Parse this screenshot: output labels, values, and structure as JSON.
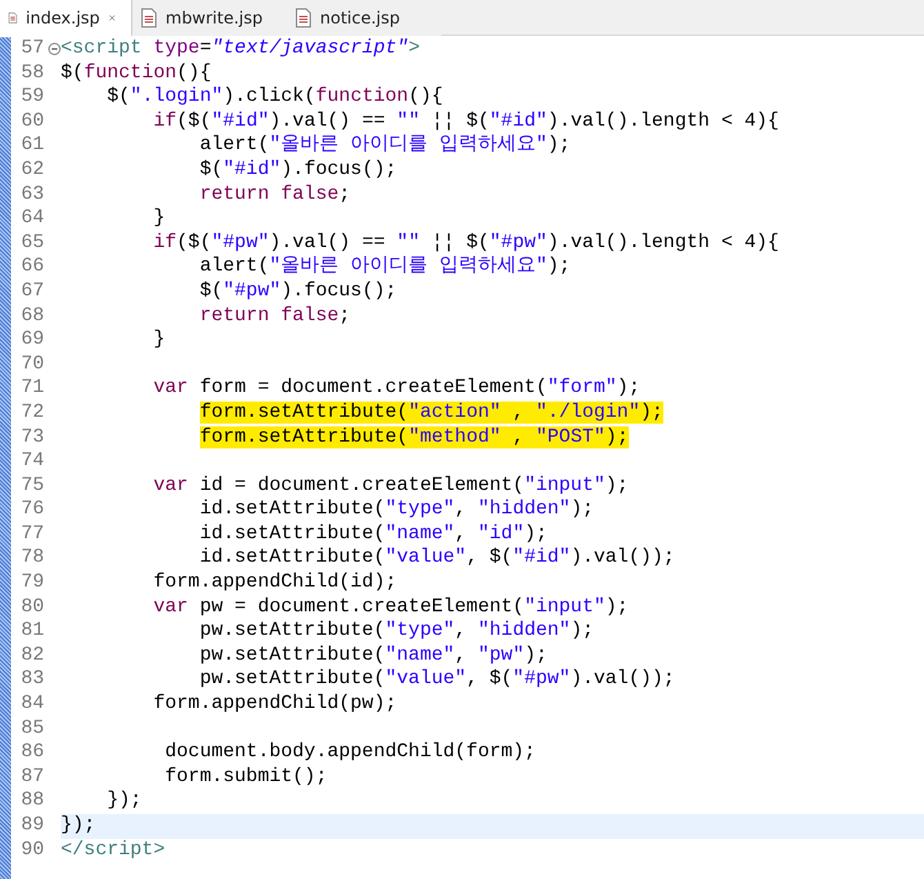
{
  "tabs": [
    {
      "label": "index.jsp",
      "selected": true
    },
    {
      "label": "mbwrite.jsp",
      "selected": false
    },
    {
      "label": "notice.jsp",
      "selected": false
    }
  ],
  "lines": [
    {
      "number": "57",
      "fold": true,
      "tokens": [
        {
          "kind": "tag",
          "text": "<script"
        },
        {
          "kind": "attr",
          "text": " type"
        },
        {
          "kind": "plain",
          "text": "="
        },
        {
          "kind": "attrvalue",
          "text": "\"text/javascript\""
        },
        {
          "kind": "tag",
          "text": ">"
        }
      ]
    },
    {
      "number": "58",
      "tokens": [
        {
          "kind": "plain",
          "text": "$("
        },
        {
          "kind": "keyword",
          "text": "function"
        },
        {
          "kind": "plain",
          "text": "(){"
        }
      ]
    },
    {
      "number": "59",
      "tokens": [
        {
          "kind": "plain",
          "text": "    $("
        },
        {
          "kind": "string",
          "text": "\".login\""
        },
        {
          "kind": "plain",
          "text": ").click("
        },
        {
          "kind": "keyword",
          "text": "function"
        },
        {
          "kind": "plain",
          "text": "(){"
        }
      ]
    },
    {
      "number": "60",
      "tokens": [
        {
          "kind": "keyword",
          "text": "        if"
        },
        {
          "kind": "plain",
          "text": "($("
        },
        {
          "kind": "string",
          "text": "\"#id\""
        },
        {
          "kind": "plain",
          "text": ").val() == "
        },
        {
          "kind": "string",
          "text": "\"\""
        },
        {
          "kind": "plain",
          "text": " ¦¦ $("
        },
        {
          "kind": "string",
          "text": "\"#id\""
        },
        {
          "kind": "plain",
          "text": ").val().length < 4){"
        }
      ]
    },
    {
      "number": "61",
      "tokens": [
        {
          "kind": "plain",
          "text": "            alert("
        },
        {
          "kind": "string",
          "text": "\"올바른 아이디를 입력하세요\""
        },
        {
          "kind": "plain",
          "text": ");"
        }
      ]
    },
    {
      "number": "62",
      "tokens": [
        {
          "kind": "plain",
          "text": "            $("
        },
        {
          "kind": "string",
          "text": "\"#id\""
        },
        {
          "kind": "plain",
          "text": ").focus();"
        }
      ]
    },
    {
      "number": "63",
      "tokens": [
        {
          "kind": "keyword",
          "text": "            return false"
        },
        {
          "kind": "plain",
          "text": ";"
        }
      ]
    },
    {
      "number": "64",
      "tokens": [
        {
          "kind": "plain",
          "text": "        }"
        }
      ]
    },
    {
      "number": "65",
      "tokens": [
        {
          "kind": "keyword",
          "text": "        if"
        },
        {
          "kind": "plain",
          "text": "($("
        },
        {
          "kind": "string",
          "text": "\"#pw\""
        },
        {
          "kind": "plain",
          "text": ").val() == "
        },
        {
          "kind": "string",
          "text": "\"\""
        },
        {
          "kind": "plain",
          "text": " ¦¦ $("
        },
        {
          "kind": "string",
          "text": "\"#pw\""
        },
        {
          "kind": "plain",
          "text": ").val().length < 4){"
        }
      ]
    },
    {
      "number": "66",
      "tokens": [
        {
          "kind": "plain",
          "text": "            alert("
        },
        {
          "kind": "string",
          "text": "\"올바른 아이디를 입력하세요\""
        },
        {
          "kind": "plain",
          "text": ");"
        }
      ]
    },
    {
      "number": "67",
      "tokens": [
        {
          "kind": "plain",
          "text": "            $("
        },
        {
          "kind": "string",
          "text": "\"#pw\""
        },
        {
          "kind": "plain",
          "text": ").focus();"
        }
      ]
    },
    {
      "number": "68",
      "tokens": [
        {
          "kind": "keyword",
          "text": "            return false"
        },
        {
          "kind": "plain",
          "text": ";"
        }
      ]
    },
    {
      "number": "69",
      "tokens": [
        {
          "kind": "plain",
          "text": "        }"
        }
      ]
    },
    {
      "number": "70"
    },
    {
      "number": "71",
      "tokens": [
        {
          "kind": "keyword",
          "text": "        var"
        },
        {
          "kind": "plain",
          "text": " form = document.createElement("
        },
        {
          "kind": "string",
          "text": "\"form\""
        },
        {
          "kind": "plain",
          "text": ");"
        }
      ]
    },
    {
      "number": "72",
      "highlighted": true,
      "tokens": [
        {
          "kind": "plain",
          "text": "            form.setAttribute("
        },
        {
          "kind": "string",
          "text": "\"action\""
        },
        {
          "kind": "plain",
          "text": " , "
        },
        {
          "kind": "string",
          "text": "\"./login\""
        },
        {
          "kind": "plain",
          "text": ");"
        }
      ]
    },
    {
      "number": "73",
      "highlighted": true,
      "tokens": [
        {
          "kind": "plain",
          "text": "            form.setAttribute("
        },
        {
          "kind": "string",
          "text": "\"method\""
        },
        {
          "kind": "plain",
          "text": " , "
        },
        {
          "kind": "string",
          "text": "\"POST\""
        },
        {
          "kind": "plain",
          "text": ");"
        }
      ]
    },
    {
      "number": "74"
    },
    {
      "number": "75",
      "tokens": [
        {
          "kind": "keyword",
          "text": "        var"
        },
        {
          "kind": "plain",
          "text": " id = document.createElement("
        },
        {
          "kind": "string",
          "text": "\"input\""
        },
        {
          "kind": "plain",
          "text": ");"
        }
      ]
    },
    {
      "number": "76",
      "tokens": [
        {
          "kind": "plain",
          "text": "            id.setAttribute("
        },
        {
          "kind": "string",
          "text": "\"type\""
        },
        {
          "kind": "plain",
          "text": ", "
        },
        {
          "kind": "string",
          "text": "\"hidden\""
        },
        {
          "kind": "plain",
          "text": ");"
        }
      ]
    },
    {
      "number": "77",
      "tokens": [
        {
          "kind": "plain",
          "text": "            id.setAttribute("
        },
        {
          "kind": "string",
          "text": "\"name\""
        },
        {
          "kind": "plain",
          "text": ", "
        },
        {
          "kind": "string",
          "text": "\"id\""
        },
        {
          "kind": "plain",
          "text": ");"
        }
      ]
    },
    {
      "number": "78",
      "tokens": [
        {
          "kind": "plain",
          "text": "            id.setAttribute("
        },
        {
          "kind": "string",
          "text": "\"value\""
        },
        {
          "kind": "plain",
          "text": ", $("
        },
        {
          "kind": "string",
          "text": "\"#id\""
        },
        {
          "kind": "plain",
          "text": ").val());"
        }
      ]
    },
    {
      "number": "79",
      "tokens": [
        {
          "kind": "plain",
          "text": "        form.appendChild(id);"
        }
      ]
    },
    {
      "number": "80",
      "tokens": [
        {
          "kind": "keyword",
          "text": "        var"
        },
        {
          "kind": "plain",
          "text": " pw = document.createElement("
        },
        {
          "kind": "string",
          "text": "\"input\""
        },
        {
          "kind": "plain",
          "text": ");"
        }
      ]
    },
    {
      "number": "81",
      "tokens": [
        {
          "kind": "plain",
          "text": "            pw.setAttribute("
        },
        {
          "kind": "string",
          "text": "\"type\""
        },
        {
          "kind": "plain",
          "text": ", "
        },
        {
          "kind": "string",
          "text": "\"hidden\""
        },
        {
          "kind": "plain",
          "text": ");"
        }
      ]
    },
    {
      "number": "82",
      "tokens": [
        {
          "kind": "plain",
          "text": "            pw.setAttribute("
        },
        {
          "kind": "string",
          "text": "\"name\""
        },
        {
          "kind": "plain",
          "text": ", "
        },
        {
          "kind": "string",
          "text": "\"pw\""
        },
        {
          "kind": "plain",
          "text": ");"
        }
      ]
    },
    {
      "number": "83",
      "tokens": [
        {
          "kind": "plain",
          "text": "            pw.setAttribute("
        },
        {
          "kind": "string",
          "text": "\"value\""
        },
        {
          "kind": "plain",
          "text": ", $("
        },
        {
          "kind": "string",
          "text": "\"#pw\""
        },
        {
          "kind": "plain",
          "text": ").val());"
        }
      ]
    },
    {
      "number": "84",
      "tokens": [
        {
          "kind": "plain",
          "text": "        form.appendChild(pw);"
        }
      ]
    },
    {
      "number": "85"
    },
    {
      "number": "86",
      "tokens": [
        {
          "kind": "plain",
          "text": "         document.body.appendChild(form);"
        }
      ]
    },
    {
      "number": "87",
      "tokens": [
        {
          "kind": "plain",
          "text": "         form.submit();"
        }
      ]
    },
    {
      "number": "88",
      "tokens": [
        {
          "kind": "plain",
          "text": "    });"
        }
      ]
    },
    {
      "number": "89",
      "current": true,
      "tokens": [
        {
          "kind": "plain",
          "text": "});"
        }
      ]
    },
    {
      "number": "90",
      "tokens": [
        {
          "kind": "tag",
          "text": "</script>"
        }
      ]
    }
  ]
}
